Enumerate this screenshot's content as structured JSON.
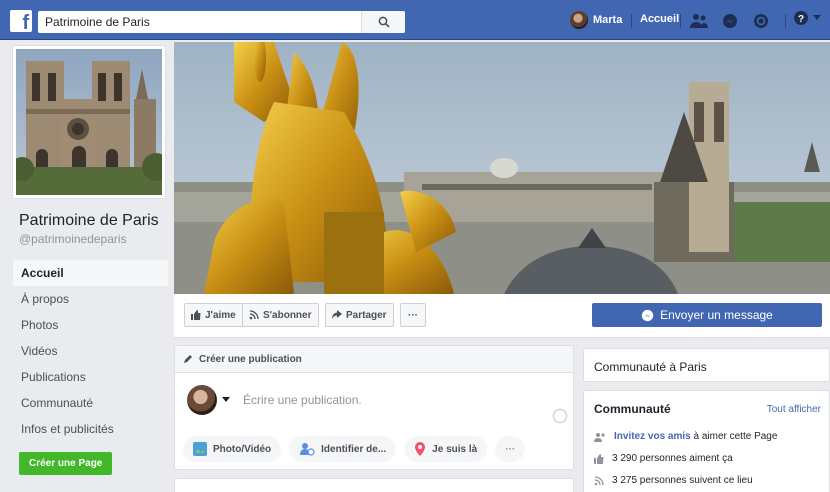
{
  "topbar": {
    "logo": "f",
    "search_value": "Patrimoine de Paris",
    "user_name": "Marta",
    "home_label": "Accueil",
    "icons": [
      "friends-icon",
      "messenger-icon",
      "notifications-icon",
      "help-icon",
      "caret-down-icon"
    ]
  },
  "sidebar": {
    "page_name": "Patrimoine de Paris",
    "page_handle": "@patrimoinedeparis",
    "items": [
      {
        "label": "Accueil",
        "active": true
      },
      {
        "label": "À propos"
      },
      {
        "label": "Photos"
      },
      {
        "label": "Vidéos"
      },
      {
        "label": "Publications"
      },
      {
        "label": "Communauté"
      },
      {
        "label": "Infos et publicités"
      }
    ],
    "create_page_label": "Créer une Page"
  },
  "actions": {
    "like_label": "J'aime",
    "follow_label": "S'abonner",
    "share_label": "Partager",
    "more_label": "···",
    "message_label": "Envoyer un message"
  },
  "composer": {
    "title": "Créer une publication",
    "placeholder": "Écrire une publication.",
    "pills": [
      "Photo/Vidéo",
      "Identifier de...",
      "Je suis là",
      "···"
    ]
  },
  "right": {
    "community_paris": "Communauté à Paris",
    "community_title": "Communauté",
    "see_all": "Tout afficher",
    "invite_link": "Invitez vos amis",
    "invite_rest": "à aimer cette Page",
    "likes": "3 290 personnes aiment ça",
    "follows": "3 275 personnes suivent ce lieu"
  },
  "colors": {
    "brand": "#4267b2",
    "create_page": "#42b72a",
    "background": "#e9ebee"
  }
}
